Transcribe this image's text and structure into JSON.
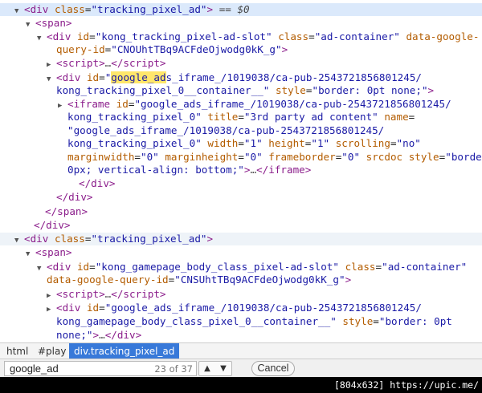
{
  "lines": [
    {
      "selected": true,
      "html": "<span class='tw'>▼</span><span class='t'>&lt;div</span> <span class='a'>class</span>=<span class='v'>\"tracking_pixel_ad\"</span><span class='t'>&gt;</span> <span class='sfx'>== $0</span>"
    },
    {
      "html": "<span class='tw'>▼</span><span class='t'>&lt;span&gt;</span>"
    },
    {
      "html": "<span class='tw'>▼</span><span class='t'>&lt;div</span> <span class='a'>id</span>=<span class='v'>\"kong_tracking_pixel-ad-slot\"</span> <span class='a'>class</span>=<span class='v'>\"ad-container\"</span> <span class='a'>data-google-</span>"
    },
    {
      "html": "<span class='a'>query-id</span>=<span class='v'>\"CNOUhtTBq9ACFdeOjwodg0kK_g\"</span><span class='t'>&gt;</span>"
    },
    {
      "html": "<span class='tw'>▶</span><span class='t'>&lt;script&gt;</span><span class='g'>…</span><span class='t'>&lt;/script&gt;</span>"
    },
    {
      "html": "<span class='tw'>▼</span><span class='t'>&lt;div</span> <span class='a'>id</span>=<span class='v'>\"<span class='m'>google_ad</span>s_iframe_/1019038/ca-pub-2543721856801245/</span>"
    },
    {
      "html": "<span class='v'>kong_tracking_pixel_0__container__\"</span> <span class='a'>style</span>=<span class='v'>\"border: 0pt none;\"</span><span class='t'>&gt;</span>"
    },
    {
      "html": "<span class='tw'>▶</span><span class='t'>&lt;iframe</span> <span class='a'>id</span>=<span class='v'>\"google_ads_iframe_/1019038/ca-pub-2543721856801245/</span>"
    },
    {
      "html": "<span class='v'>kong_tracking_pixel_0\"</span> <span class='a'>title</span>=<span class='v'>\"3rd party ad content\"</span> <span class='a'>name</span>="
    },
    {
      "html": "<span class='v'>\"google_ads_iframe_/1019038/ca-pub-2543721856801245/</span>"
    },
    {
      "html": "<span class='v'>kong_tracking_pixel_0\"</span> <span class='a'>width</span>=<span class='v'>\"1\"</span> <span class='a'>height</span>=<span class='v'>\"1\"</span> <span class='a'>scrolling</span>=<span class='v'>\"no\"</span>"
    },
    {
      "html": "<span class='a'>marginwidth</span>=<span class='v'>\"0\"</span> <span class='a'>marginheight</span>=<span class='v'>\"0\"</span> <span class='a'>frameborder</span>=<span class='v'>\"0\"</span> <span class='a'>srcdoc</span> <span class='a'>style</span>=<span class='v'>\"border:</span>"
    },
    {
      "html": "<span class='v'>0px; vertical-align: bottom;\"</span><span class='t'>&gt;</span><span class='g'>…</span><span class='t'>&lt;/iframe&gt;</span>"
    },
    {
      "html": "<span class='t'>&lt;/div&gt;</span>"
    },
    {
      "html": "<span class='t'>&lt;/div&gt;</span>"
    },
    {
      "html": "<span class='t'>&lt;/span&gt;</span>"
    },
    {
      "html": "<span class='t'>&lt;/div&gt;</span>"
    },
    {
      "hover": true,
      "html": "<span class='tw'>▼</span><span class='t'>&lt;div</span> <span class='a'>class</span>=<span class='v'>\"tracking_pixel_ad\"</span><span class='t'>&gt;</span>"
    },
    {
      "html": "<span class='tw'>▼</span><span class='t'>&lt;span&gt;</span>"
    },
    {
      "html": "<span class='tw'>▼</span><span class='t'>&lt;div</span> <span class='a'>id</span>=<span class='v'>\"kong_gamepage_body_class_pixel-ad-slot\"</span> <span class='a'>class</span>=<span class='v'>\"ad-container\"</span>"
    },
    {
      "html": "<span class='a'>data-google-query-id</span>=<span class='v'>\"CNSUhtTBq9ACFdeOjwodg0kK_g\"</span><span class='t'>&gt;</span>"
    },
    {
      "html": "<span class='tw'>▶</span><span class='t'>&lt;script&gt;</span><span class='g'>…</span><span class='t'>&lt;/script&gt;</span>"
    },
    {
      "html": "<span class='tw'>▶</span><span class='t'>&lt;div</span> <span class='a'>id</span>=<span class='v'>\"google_ads_iframe_/1019038/ca-pub-2543721856801245/</span>"
    },
    {
      "html": "<span class='v'>kong_gamepage_body_class_pixel_0__container__\"</span> <span class='a'>style</span>=<span class='v'>\"border: 0pt</span>"
    },
    {
      "html": "<span class='v'>none;\"</span><span class='t'>&gt;</span><span class='g'>…</span><span class='t'>&lt;/div&gt;</span>"
    }
  ],
  "breadcrumbs": [
    "html",
    "#play",
    "div.tracking_pixel_ad"
  ],
  "find": {
    "query": "google_ad",
    "count": "23 of 37",
    "prev": "▲",
    "next": "▼",
    "cancel": "Cancel"
  },
  "gutter_icon": "•••",
  "watermark": "[804x632] https://upic.me/"
}
